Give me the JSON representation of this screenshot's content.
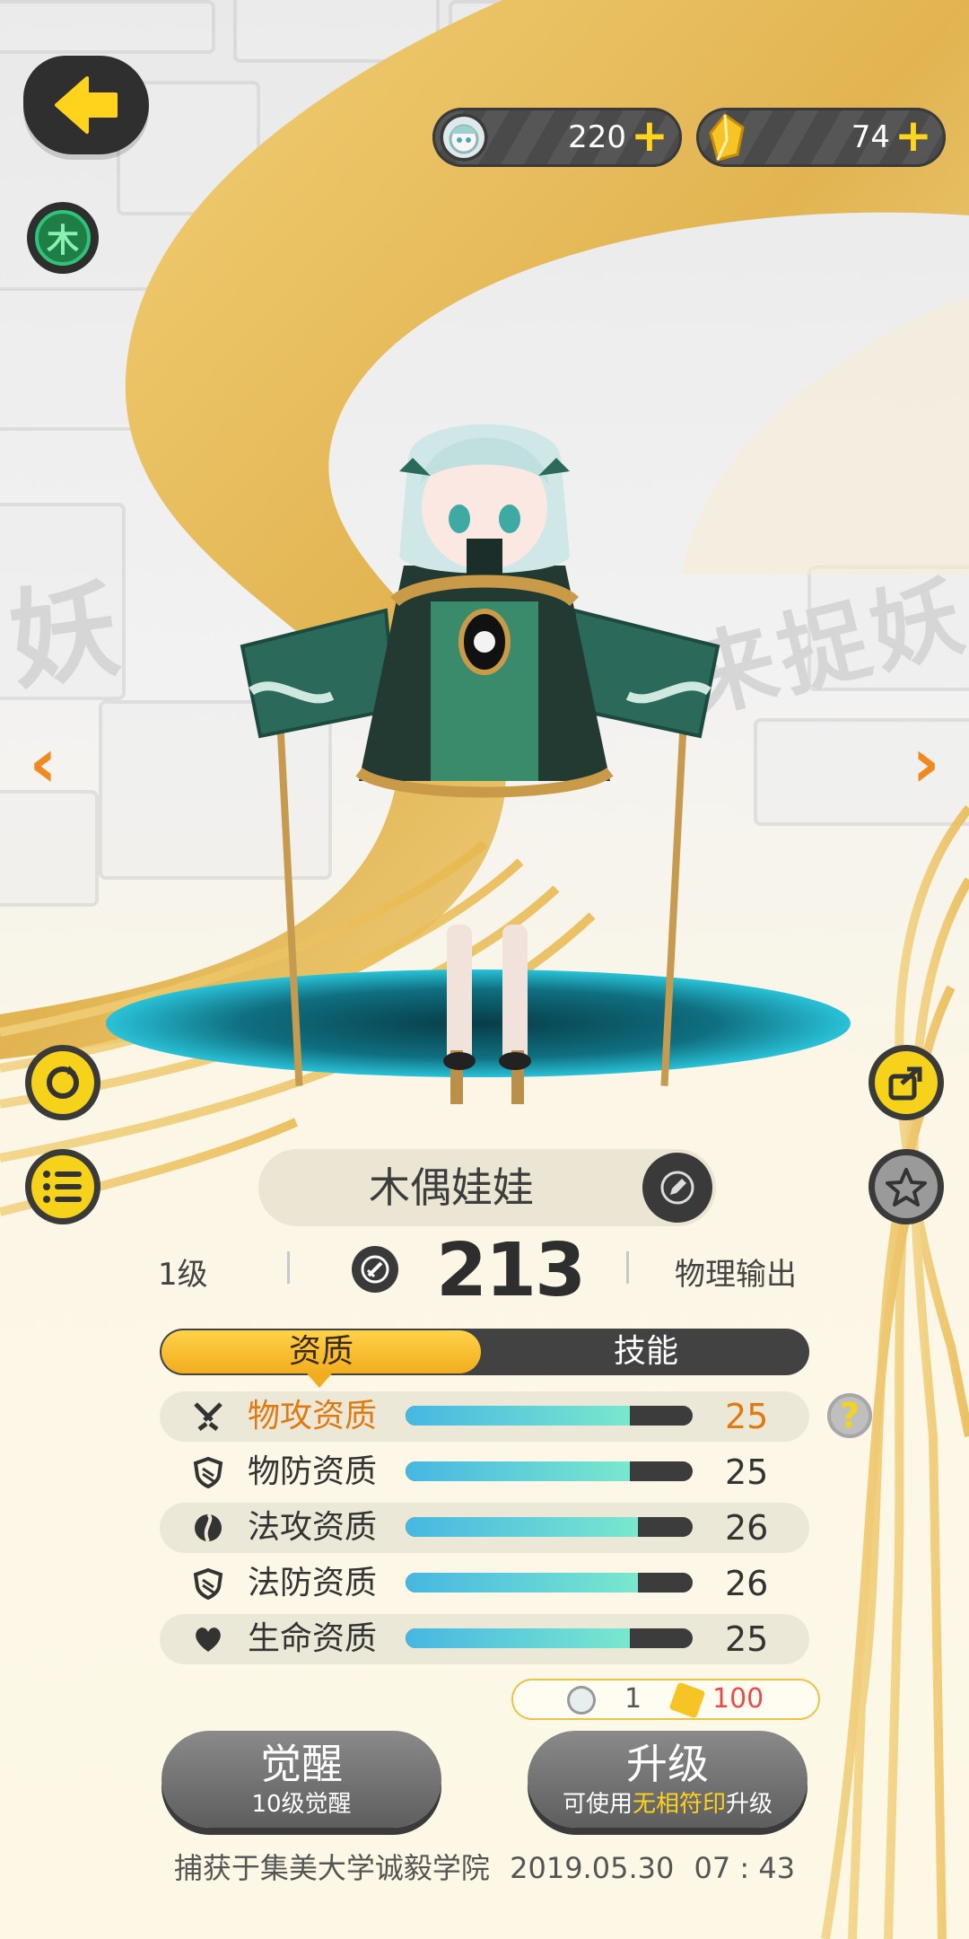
{
  "top_bar": {
    "element_label": "木",
    "currencies": [
      {
        "icon": "spirit-face-icon",
        "value": "220",
        "plus": "+"
      },
      {
        "icon": "gold-crystal-icon",
        "value": "74",
        "plus": "+"
      }
    ]
  },
  "character": {
    "name": "木偶娃娃",
    "level": "1级",
    "power": "213",
    "role": "物理输出"
  },
  "tabs": [
    {
      "label": "资质",
      "active": true
    },
    {
      "label": "技能",
      "active": false
    }
  ],
  "aptitudes": [
    {
      "icon": "crossed-swords-icon",
      "label": "物攻资质",
      "value": "25",
      "fill": 0.78,
      "highlighted": true
    },
    {
      "icon": "shield-icon",
      "label": "物防资质",
      "value": "25",
      "fill": 0.78,
      "highlighted": false
    },
    {
      "icon": "magic-orb-icon",
      "label": "法攻资质",
      "value": "26",
      "fill": 0.81,
      "highlighted": false
    },
    {
      "icon": "shield-icon",
      "label": "法防资质",
      "value": "26",
      "fill": 0.81,
      "highlighted": false
    },
    {
      "icon": "heart-icon",
      "label": "生命资质",
      "value": "25",
      "fill": 0.78,
      "highlighted": false
    }
  ],
  "help_label": "?",
  "cost": {
    "spirit_count": "1",
    "gold_count": "100"
  },
  "buttons": {
    "awaken": {
      "label": "觉醒",
      "sub": "10级觉醒"
    },
    "upgrade": {
      "label": "升级",
      "sub_prefix": "可使用",
      "sub_highlight": "无相符印",
      "sub_suffix": "升级"
    }
  },
  "footer": {
    "text": "捕获于集美大学诚毅学院",
    "date": "2019.05.30",
    "time": "07 : 43"
  },
  "colors": {
    "accent_yellow": "#f6d21a",
    "highlight_orange": "#e07a10",
    "bar_fill": "#46b7e2",
    "element_green": "#2ec27a"
  }
}
